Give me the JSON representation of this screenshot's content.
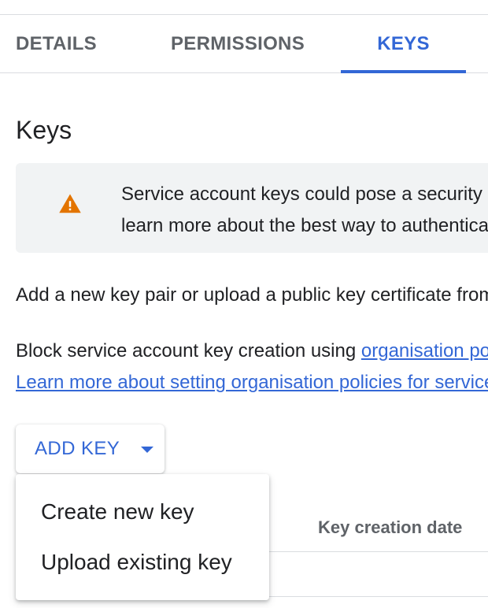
{
  "tabs": [
    {
      "label": "DETAILS",
      "active": false
    },
    {
      "label": "PERMISSIONS",
      "active": false
    },
    {
      "label": "KEYS",
      "active": true
    }
  ],
  "section": {
    "title": "Keys"
  },
  "warning": {
    "icon": "warning-icon",
    "line1": "Service account keys could pose a security risk if compromised. We recommend that you avoid downloading",
    "line2": "learn more about the best way to authenticate service accounts on Google Cloud here."
  },
  "body": {
    "add_pair_text": "Add a new key pair or upload a public key certificate from an existing key pair.",
    "block_prefix": "Block service account key creation using ",
    "block_link": "organisation policies.",
    "learn_more_link": "Learn more about setting organisation policies for service accounts"
  },
  "add_key": {
    "label": "ADD KEY",
    "icon": "caret-down-icon"
  },
  "menu": {
    "items": [
      {
        "label": "Create new key"
      },
      {
        "label": "Upload existing key"
      }
    ]
  },
  "table": {
    "columns": [
      "Key creation date"
    ]
  },
  "colors": {
    "accent": "#3367d6",
    "warning": "#e37400",
    "surface": "#f1f3f4",
    "divider": "#dadce0"
  }
}
